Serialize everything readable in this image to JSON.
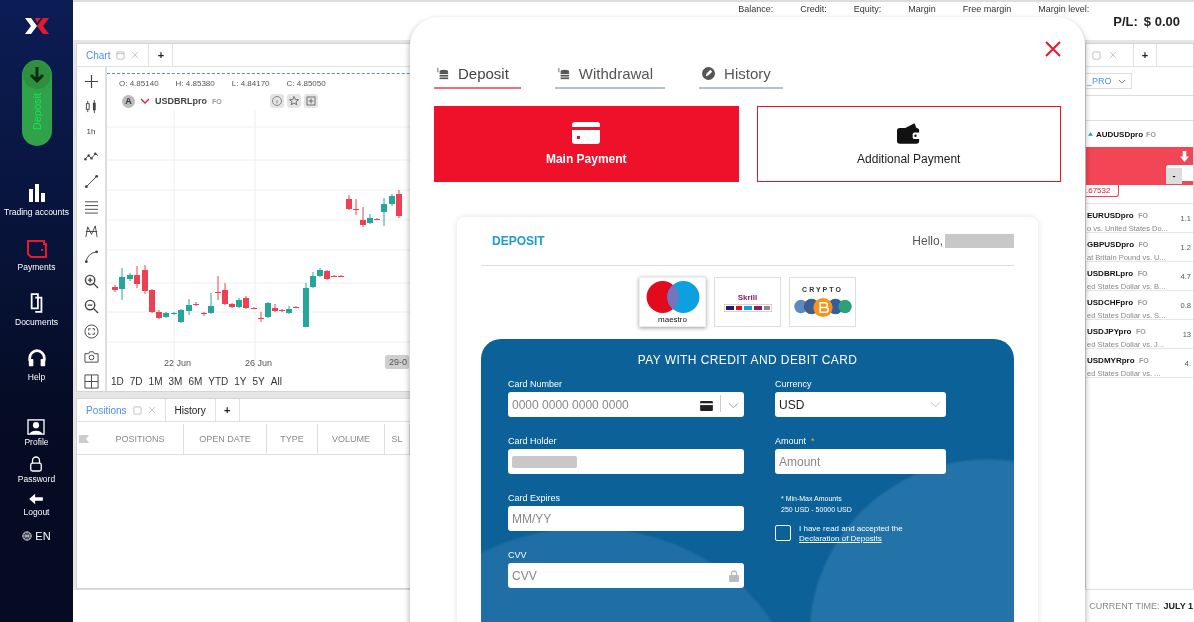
{
  "sidebar": {
    "deposit_button": "Deposit",
    "items": [
      {
        "label": "Trading accounts",
        "selected": false
      },
      {
        "label": "Payments",
        "selected": true
      },
      {
        "label": "Documents",
        "selected": false
      },
      {
        "label": "Help",
        "selected": false
      }
    ],
    "account_items": [
      "Profile",
      "Password",
      "Logout"
    ],
    "language": "EN"
  },
  "top_bar": {
    "stats": [
      "Balance:",
      "Credit:",
      "Equity:",
      "Margin",
      "Free margin",
      "Margin level:"
    ],
    "pl_label": "P/L:",
    "pl_value": "$ 0.00"
  },
  "chart_panel": {
    "tabs": [
      {
        "label": "Chart",
        "selected": true
      }
    ],
    "add_tab": "+",
    "ohlc": [
      "O: 4.85140",
      "H: 4.85380",
      "L: 4.84170",
      "C: 4.85050"
    ],
    "symbol_badge": "A",
    "symbol": "USDBRLpro",
    "symbol_tag": "FO",
    "timeframe": "1h",
    "x_labels": [
      "22 Jun",
      "26 Jun"
    ],
    "cursor_date": "29-0",
    "ranges": [
      "1D",
      "7D",
      "1M",
      "3M",
      "6M",
      "YTD",
      "1Y",
      "5Y",
      "All"
    ]
  },
  "positions_panel": {
    "tabs": [
      {
        "label": "Positions",
        "selected": true
      },
      {
        "label": "History",
        "selected": false
      }
    ],
    "add_tab": "+",
    "columns": [
      "POSITIONS",
      "OPEN DATE",
      "TYPE",
      "VOLUME",
      "SL"
    ]
  },
  "market_panel": {
    "add_tab": "+",
    "account_select": "_PRO",
    "symbol": "AUDUSDpro",
    "symbol_tag": "FO",
    "quantity_minus": "-",
    "price": ".67532",
    "instruments": [
      {
        "symbol": "EURUSDpro",
        "tag": "FO",
        "description": "o vs. United States Do...",
        "value": "1.1"
      },
      {
        "symbol": "GBPUSDpro",
        "tag": "FO",
        "description": "at Britain Pound vs. U...",
        "value": "1.2"
      },
      {
        "symbol": "USDBRLpro",
        "tag": "FO",
        "description": "ed States Dollar vs. B...",
        "value": "4.7"
      },
      {
        "symbol": "USDCHFpro",
        "tag": "FO",
        "description": "ed States Dollar vs. S...",
        "value": "0.8"
      },
      {
        "symbol": "USDJPYpro",
        "tag": "FO",
        "description": "ed States Dollar vs. J...",
        "value": "13"
      },
      {
        "symbol": "USDMYRpro",
        "tag": "FO",
        "description": "ed States Dollar vs. ...",
        "value": "4."
      }
    ]
  },
  "status_bar": {
    "current_time_label": "CURRENT TIME:",
    "current_time_value": "JULY 1"
  },
  "deposit_modal": {
    "tabs": [
      {
        "label": "Deposit",
        "selected": true
      },
      {
        "label": "Withdrawal",
        "selected": false
      },
      {
        "label": "History",
        "selected": false
      }
    ],
    "payment_types": [
      {
        "label": "Main Payment",
        "selected": true
      },
      {
        "label": "Additional Payment",
        "selected": false
      }
    ],
    "card": {
      "title": "DEPOSIT",
      "greeting": "Hello,",
      "methods": [
        {
          "kind": "maestro",
          "label": "maestro",
          "selected": true
        },
        {
          "kind": "skrill",
          "label": "Skrill",
          "selected": false
        },
        {
          "kind": "crypto",
          "label": "CRYPTO",
          "selected": false
        }
      ],
      "form_title": "PAY WITH CREDIT AND DEBIT CARD",
      "card_number": {
        "label": "Card Number",
        "placeholder": "0000 0000 0000 0000"
      },
      "card_holder": {
        "label": "Card Holder"
      },
      "card_expires": {
        "label": "Card Expires",
        "placeholder": "MM/YY"
      },
      "cvv": {
        "label": "CVV",
        "placeholder": "CVV"
      },
      "currency": {
        "label": "Currency",
        "value": "USD"
      },
      "amount": {
        "label": "Amount",
        "required_mark": "*",
        "placeholder": "Amount"
      },
      "limits_title": "* Min-Max Amounts",
      "limits": "250 USD - 50000 USD",
      "agreement": {
        "text": "I have read and accepted the",
        "link": "Declaration of Deposits",
        "checked": false
      }
    }
  }
}
